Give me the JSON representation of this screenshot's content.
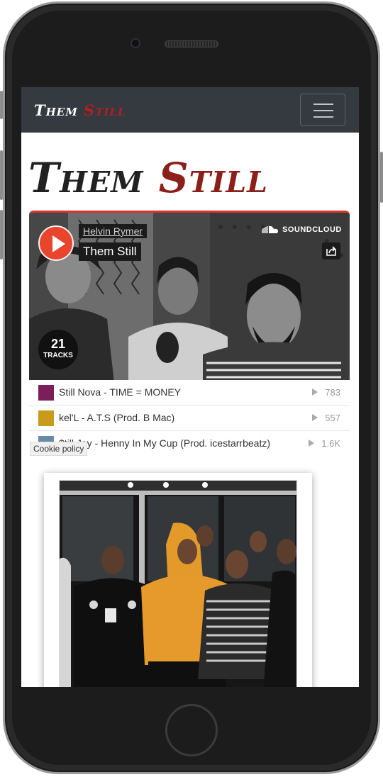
{
  "navbar": {
    "brand_word1": "Them",
    "brand_word2": "Still",
    "menu_toggle": "hamburger-icon"
  },
  "hero": {
    "title_word1": "Them",
    "title_word2": "Still"
  },
  "soundcloud": {
    "user": "Helvin Rymer",
    "set_title": "Them Still",
    "logo_text": "SOUNDCLOUD",
    "track_count": "21",
    "track_count_label": "TRACKS",
    "tracks": [
      {
        "title": "Still Nova - TIME = MONEY",
        "plays": "783",
        "thumb_color": "#7a1f5a"
      },
      {
        "title": "kel'L - A.T.S (Prod. B Mac)",
        "plays": "557",
        "thumb_color": "#c89a1e"
      },
      {
        "title": "$till Jay - Henny In My Cup (Prod. icestarrbeatz)",
        "plays": "1.6K",
        "thumb_color": "#6a8aa8"
      }
    ]
  },
  "cookie_policy": "Cookie policy",
  "colors": {
    "navbar_bg": "#343a40",
    "brand_red": "#b21f1f",
    "title_red": "#8b1f1a",
    "soundcloud_orange": "#e8452c"
  }
}
